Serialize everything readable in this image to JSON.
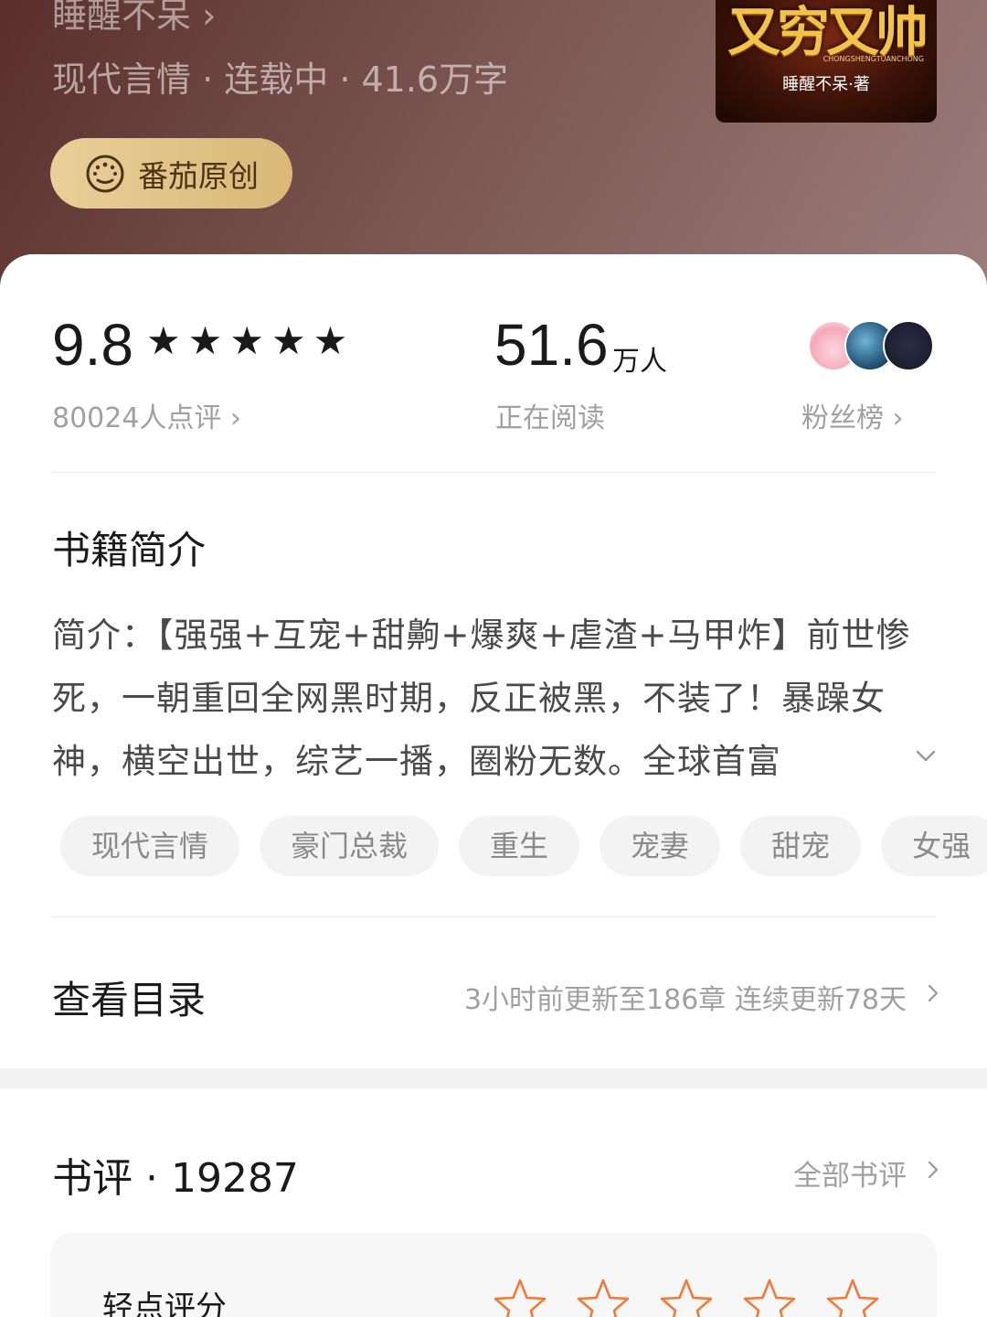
{
  "book": {
    "author_link": "睡醒不呆 ›",
    "meta": "现代言情 · 连载中 · 41.6万字",
    "badge": "番茄原创",
    "cover": {
      "title_art": "又穷又帅",
      "pinyin": "CHONGSHENGTUANCHONG",
      "byline": "睡醒不呆·著"
    }
  },
  "stats": {
    "score": "9.8",
    "stars": [
      "★",
      "★",
      "★",
      "★",
      "★"
    ],
    "rating_count": "80024人点评 ›",
    "readers_num": "51.6",
    "readers_unit": "万人",
    "readers_label": "正在阅读",
    "fans_label": "粉丝榜 ›"
  },
  "synopsis": {
    "title": "书籍简介",
    "text": "简介：【强强+互宠+甜齁+爆爽+虐渣+马甲炸】前世惨死，一朝重回全网黑时期，反正被黑，不装了！暴躁女神，横空出世，综艺一播，圈粉无数。全球首富",
    "tags": [
      "现代言情",
      "豪门总裁",
      "重生",
      "宠妻",
      "甜宠",
      "女强"
    ]
  },
  "toc": {
    "title": "查看目录",
    "info": "3小时前更新至186章 连续更新78天"
  },
  "reviews": {
    "title": "书评 · 19287",
    "all_link": "全部书评",
    "rate_label": "轻点评分"
  },
  "colors": {
    "header_start": "#5a2f2b",
    "badge_gold": "#e9cf98",
    "rate_star": "#f07a3c"
  }
}
